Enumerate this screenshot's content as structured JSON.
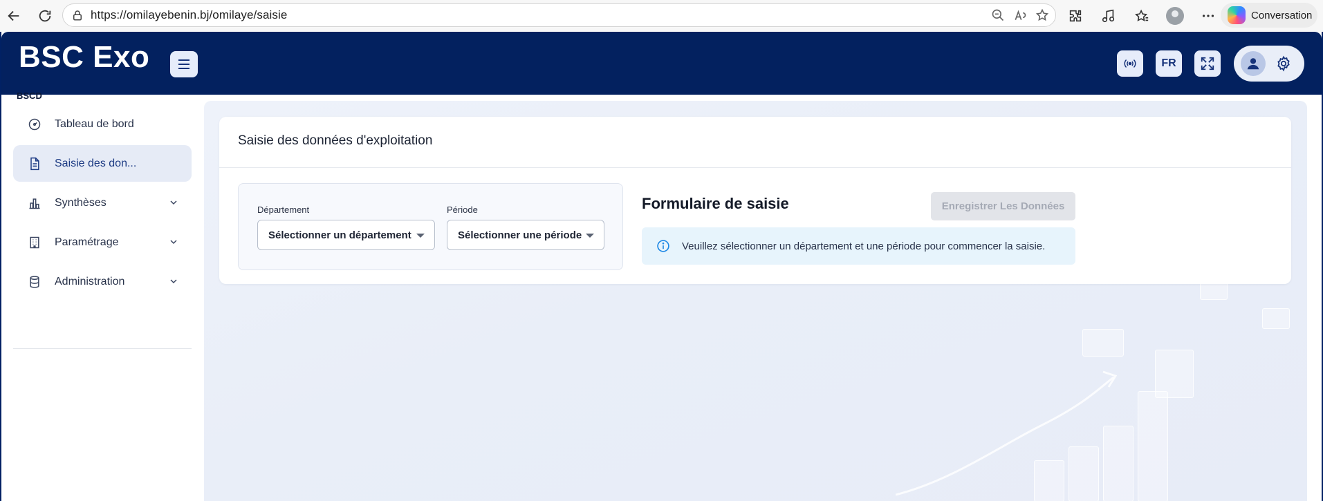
{
  "browser": {
    "url": "https://omilayebenin.bj/omilaye/saisie",
    "copilot_label": "Conversation"
  },
  "header": {
    "brand": "BSC Exo",
    "language": "FR"
  },
  "sidebar": {
    "section_label": "BSCD",
    "items": [
      {
        "label": "Tableau de bord",
        "icon": "dashboard-gauge-icon",
        "active": false,
        "expandable": false
      },
      {
        "label": "Saisie des don...",
        "icon": "document-icon",
        "active": true,
        "expandable": false
      },
      {
        "label": "Synthèses",
        "icon": "bar-chart-icon",
        "active": false,
        "expandable": true
      },
      {
        "label": "Paramétrage",
        "icon": "building-icon",
        "active": false,
        "expandable": true
      },
      {
        "label": "Administration",
        "icon": "database-icon",
        "active": false,
        "expandable": true
      }
    ]
  },
  "main": {
    "card_title": "Saisie des données d'exploitation",
    "filters": {
      "department_label": "Département",
      "department_value": "Sélectionner un département",
      "period_label": "Période",
      "period_value": "Sélectionner une période"
    },
    "form": {
      "title": "Formulaire de saisie",
      "save_label": "Enregistrer Les Données",
      "info_message": "Veuillez sélectionner un département et une période pour commencer la saisie."
    }
  },
  "colors": {
    "header_bg": "#03215f",
    "active_item_bg": "#e6ebf6",
    "info_bg": "#e7f4fc",
    "info_icon": "#1e88e5"
  }
}
